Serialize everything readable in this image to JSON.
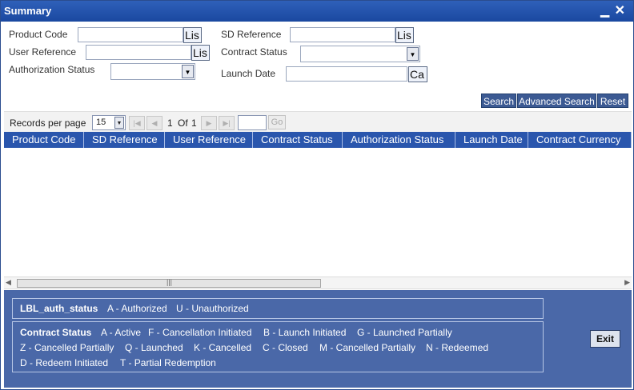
{
  "window": {
    "title": "Summary",
    "minimize_glyph": "▁",
    "close_glyph": "✕"
  },
  "form": {
    "product_code": {
      "label": "Product Code",
      "value": "",
      "lov_label": "Lis"
    },
    "sd_reference": {
      "label": "SD Reference",
      "value": "",
      "lov_label": "Lis"
    },
    "user_reference": {
      "label": "User Reference",
      "value": "",
      "lov_label": "Lis"
    },
    "contract_status": {
      "label": "Contract Status",
      "value": ""
    },
    "authorization_status": {
      "label": "Authorization Status",
      "value": ""
    },
    "launch_date": {
      "label": "Launch Date",
      "value": "",
      "calendar_label": "Ca"
    }
  },
  "actions": {
    "search": "Search",
    "advanced_search": "Advanced Search",
    "reset": "Reset"
  },
  "pager": {
    "records_per_page_label": "Records per page",
    "records_per_page": "15",
    "current_page": "1",
    "of_label": "Of",
    "total_pages": "1",
    "goto_value": "",
    "go_label": "Go"
  },
  "grid": {
    "columns": [
      "Product Code",
      "SD Reference",
      "User Reference",
      "Contract Status",
      "Authorization Status",
      "Launch Date",
      "Contract Currency"
    ],
    "rows": []
  },
  "legend": {
    "auth": {
      "title": "LBL_auth_status",
      "items": [
        "A - Authorized",
        "U - Unauthorized"
      ]
    },
    "contract": {
      "title": "Contract Status",
      "items": [
        "A - Active",
        "F - Cancellation Initiated",
        "B - Launch Initiated",
        "G - Launched Partially",
        "Z - Cancelled Partially",
        "Q - Launched",
        "K - Cancelled",
        "C - Closed",
        "M - Cancelled Partially",
        "N - Redeemed",
        "D - Redeem Initiated",
        "T - Partial Redemption"
      ]
    }
  },
  "footer": {
    "exit_label": "Exit"
  },
  "icons": {
    "dropdown": "▼",
    "first": "|◀",
    "prev": "◀",
    "next": "▶",
    "last": "▶|",
    "scroll_left": "◀",
    "scroll_right": "▶",
    "grip": "|||"
  }
}
